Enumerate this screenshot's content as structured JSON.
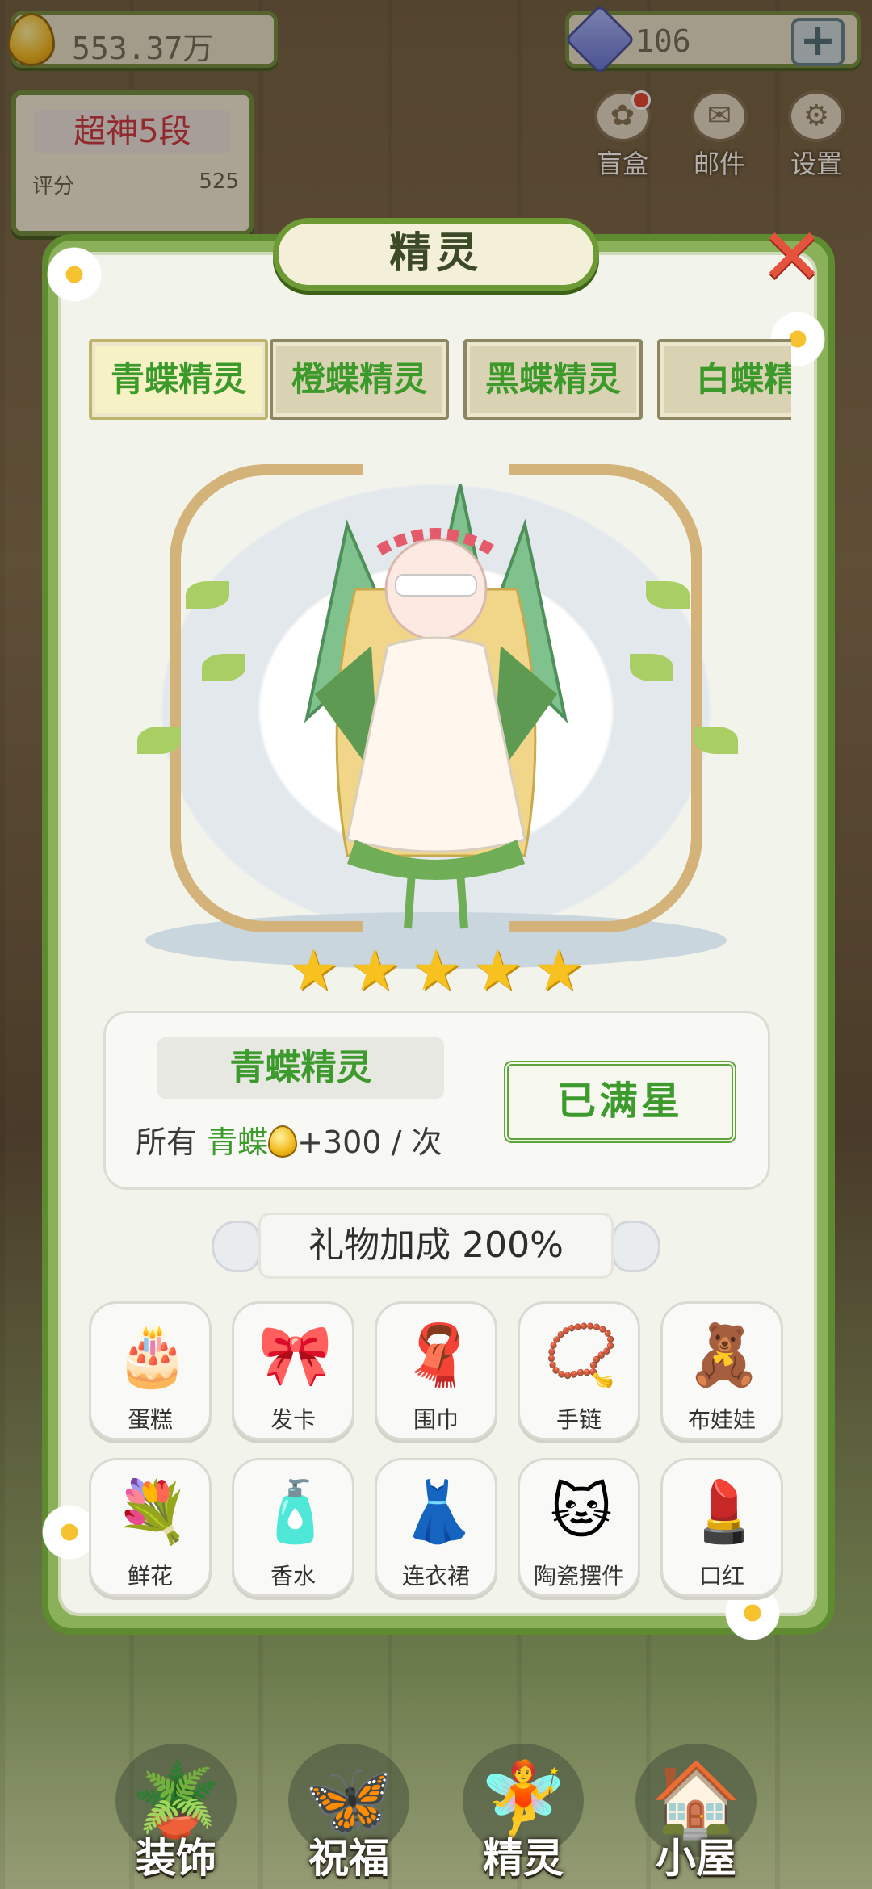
{
  "topbar": {
    "gold_value": "553.37万",
    "gem_value": "106",
    "add_label": "+",
    "rank_title": "超神5段",
    "score_label": "评分",
    "score_value": "525",
    "buttons": [
      {
        "label": "盲盒",
        "icon": "blind-box-icon"
      },
      {
        "label": "邮件",
        "icon": "mail-icon"
      },
      {
        "label": "设置",
        "icon": "gear-icon"
      }
    ]
  },
  "panel": {
    "title": "精灵",
    "close_label": "✕",
    "tabs": [
      "青蝶精灵",
      "橙蝶精灵",
      "黑蝶精灵",
      "白蝶精"
    ],
    "active_tab": 0,
    "star_count": 5,
    "fairy": {
      "name": "青蝶精灵",
      "bonus_prefix": "所有",
      "bonus_target": "青蝶",
      "bonus_amount": "+300",
      "bonus_suffix": "/ 次",
      "status_button": "已满星"
    },
    "gift_bonus": "礼物加成 200%",
    "gifts": [
      {
        "label": "蛋糕",
        "icon": "cake-icon",
        "glyph": "🎂"
      },
      {
        "label": "发卡",
        "icon": "hairpin-icon",
        "glyph": "🎀"
      },
      {
        "label": "围巾",
        "icon": "scarf-icon",
        "glyph": "🧣"
      },
      {
        "label": "手链",
        "icon": "bracelet-icon",
        "glyph": "📿"
      },
      {
        "label": "布娃娃",
        "icon": "doll-icon",
        "glyph": "🧸"
      },
      {
        "label": "鲜花",
        "icon": "flower-icon",
        "glyph": "💐"
      },
      {
        "label": "香水",
        "icon": "perfume-icon",
        "glyph": "🧴"
      },
      {
        "label": "连衣裙",
        "icon": "dress-icon",
        "glyph": "👗"
      },
      {
        "label": "陶瓷摆件",
        "icon": "ceramic-cat-icon",
        "glyph": "🐱"
      },
      {
        "label": "口红",
        "icon": "lipstick-icon",
        "glyph": "💄"
      }
    ]
  },
  "bottom_nav": [
    {
      "label": "装饰",
      "icon": "plant-icon",
      "glyph": "🪴"
    },
    {
      "label": "祝福",
      "icon": "butterfly-icon",
      "glyph": "🦋"
    },
    {
      "label": "精灵",
      "icon": "fairy-icon",
      "glyph": "🧚"
    },
    {
      "label": "小屋",
      "icon": "house-icon",
      "glyph": "🏠"
    }
  ],
  "colors": {
    "accent_green": "#3d9a2c",
    "vine_green": "#6d9a34",
    "rank_red": "#c8323c",
    "star_gold": "#f7c21f"
  }
}
